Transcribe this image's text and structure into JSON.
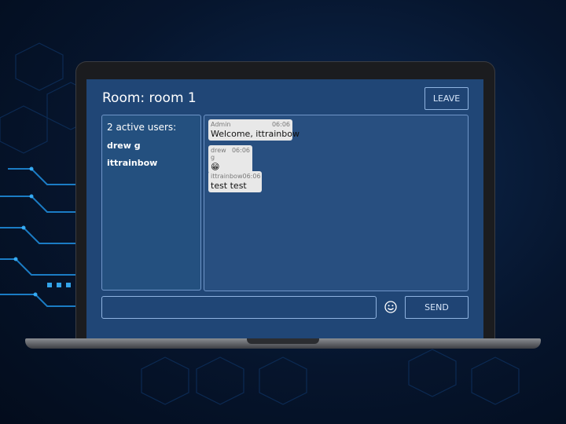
{
  "room": {
    "title": "Room: room 1"
  },
  "header": {
    "leave_label": "LEAVE"
  },
  "users": {
    "count_label": "2 active users:",
    "list": [
      "drew g",
      "ittrainbow"
    ]
  },
  "messages": [
    {
      "author": "Admin",
      "time": "06:06",
      "text": "Welcome, ittrainbow"
    },
    {
      "author": "drew g",
      "time": "06:06",
      "text": "😁"
    },
    {
      "author": "ittrainbow",
      "time": "06:06",
      "text": "test test"
    }
  ],
  "composer": {
    "value": "",
    "send_label": "SEND"
  },
  "icons": {
    "emoji": "smiley-face-icon"
  },
  "colors": {
    "screen_bg": "#204676",
    "panel_border": "#6f95c8",
    "bubble_bg": "#e8e8e8"
  }
}
